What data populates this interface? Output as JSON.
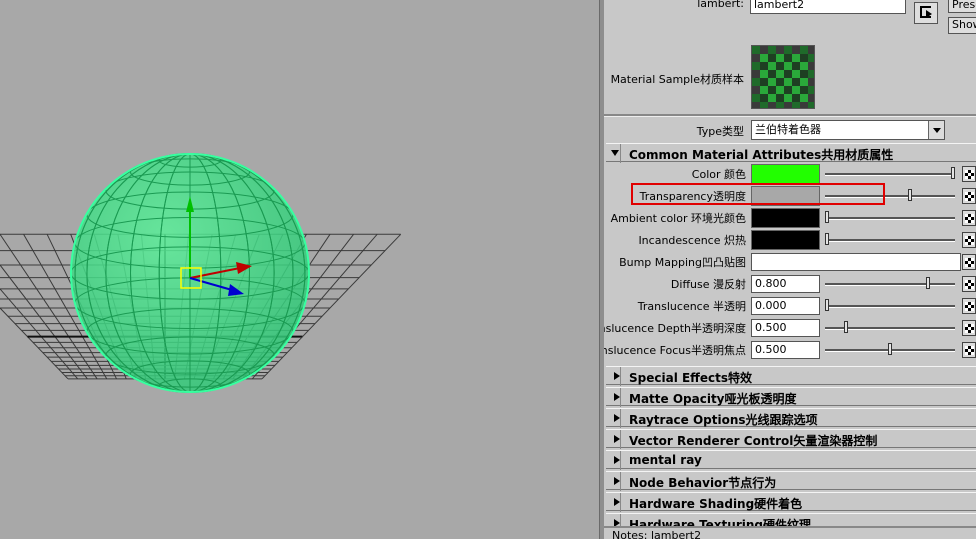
{
  "header": {
    "type_label": "lambert:",
    "node_name": "lambert2",
    "presets_btn": "Presets",
    "show_btn": "Show"
  },
  "sample": {
    "label": "Material Sample材质样本"
  },
  "type": {
    "label": "Type类型",
    "value": "兰伯特着色器"
  },
  "common": {
    "title": "Common Material Attributes共用材质属性",
    "rows": [
      {
        "label": "Color 颜色",
        "kind": "color",
        "color": "#22ff00",
        "slider": 1.0
      },
      {
        "label": "Transparency透明度",
        "kind": "color",
        "color": "#a8a8a8",
        "slider": 0.66
      },
      {
        "label": "Ambient color 环境光颜色",
        "kind": "color",
        "color": "#000000",
        "slider": 0.0
      },
      {
        "label": "Incandescence 炽热",
        "kind": "color",
        "color": "#000000",
        "slider": 0.0
      },
      {
        "label": "Bump Mapping凹凸贴图",
        "kind": "bump"
      },
      {
        "label": "Diffuse 漫反射",
        "kind": "num",
        "value": "0.800",
        "slider": 0.8
      },
      {
        "label": "Translucence 半透明",
        "kind": "num",
        "value": "0.000",
        "slider": 0.0
      },
      {
        "label": "nslucence Depth半透明深度",
        "kind": "num",
        "value": "0.500",
        "slider": 0.15
      },
      {
        "label": "nslucence Focus半透明焦点",
        "kind": "num",
        "value": "0.500",
        "slider": 0.5
      }
    ]
  },
  "sections": [
    "Special Effects特效",
    "Matte Opacity哑光板透明度",
    "Raytrace Options光线跟踪选项",
    "Vector Renderer Control矢量渲染器控制",
    "mental ray",
    "Node Behavior节点行为",
    "Hardware Shading硬件着色",
    "Hardware Texturing硬件纹理"
  ],
  "notes": {
    "label": "Notes: lambert2"
  },
  "highlight_color": "#e00000",
  "sphere_color": "#33ee88"
}
